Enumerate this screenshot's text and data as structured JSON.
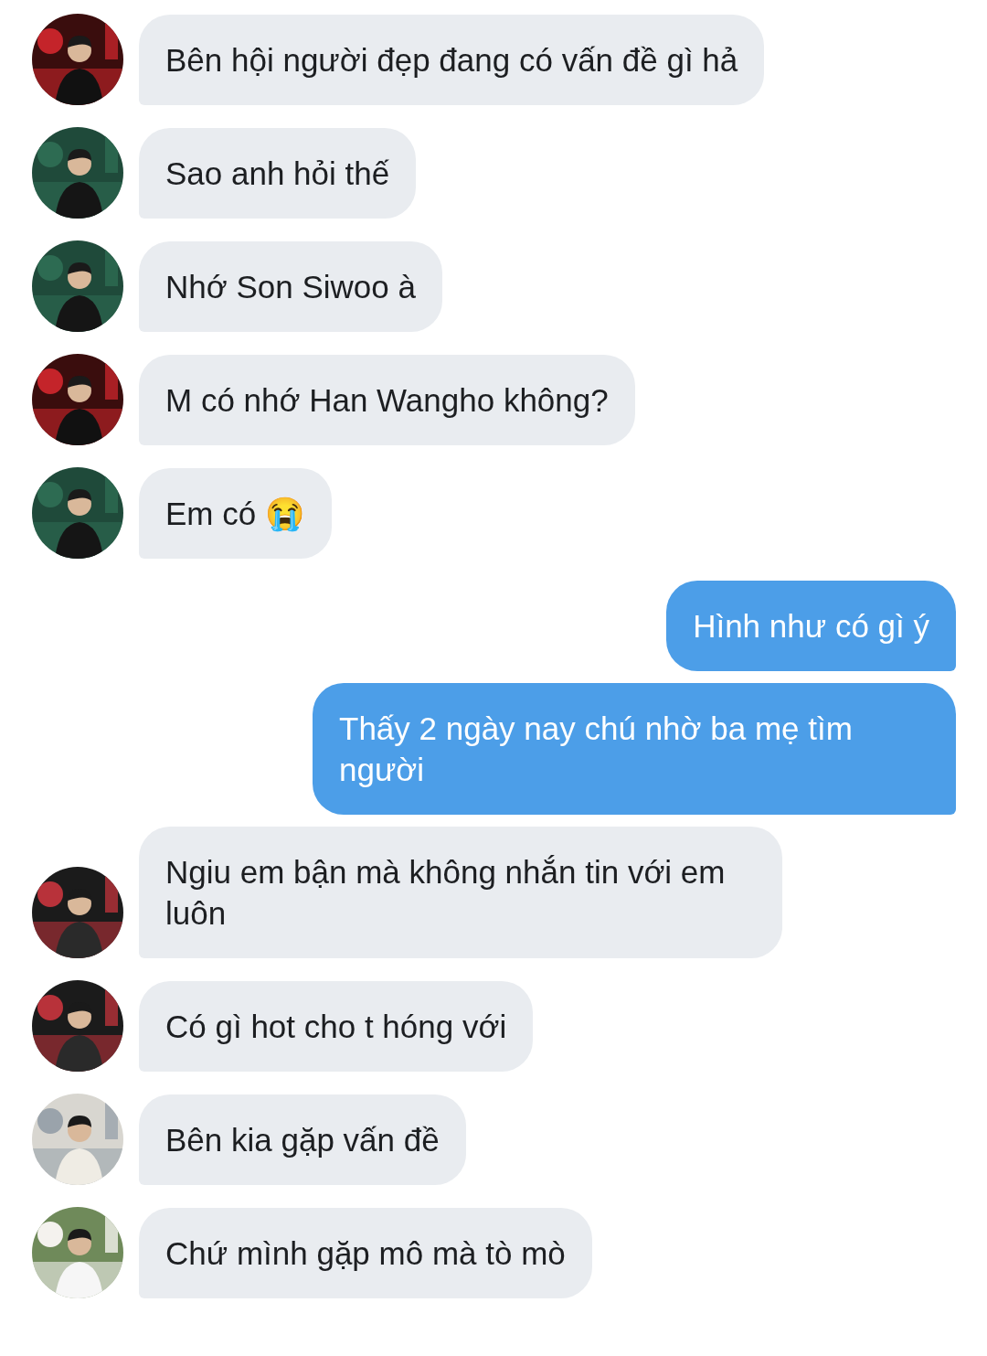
{
  "messages": [
    {
      "kind": "received",
      "text": "Bên hội người đẹp đang có vấn đề gì hả"
    },
    {
      "kind": "received",
      "text": "Sao anh hỏi thế"
    },
    {
      "kind": "received",
      "text": "Nhớ Son Siwoo à"
    },
    {
      "kind": "received",
      "text": "M có nhớ Han Wangho không?"
    },
    {
      "kind": "received",
      "text": "Em có 😭"
    },
    {
      "kind": "sent",
      "text": "Hình như có gì ý"
    },
    {
      "kind": "sent",
      "text": "Thấy 2 ngày nay chú nhờ ba mẹ tìm người"
    },
    {
      "kind": "received",
      "text": "Ngiu em bận mà không nhắn tin với em luôn"
    },
    {
      "kind": "received",
      "text": "Có gì hot cho t hóng với"
    },
    {
      "kind": "received",
      "text": "Bên kia gặp vấn đề"
    },
    {
      "kind": "received",
      "text": "Chứ mình gặp mô mà tò mò"
    }
  ]
}
